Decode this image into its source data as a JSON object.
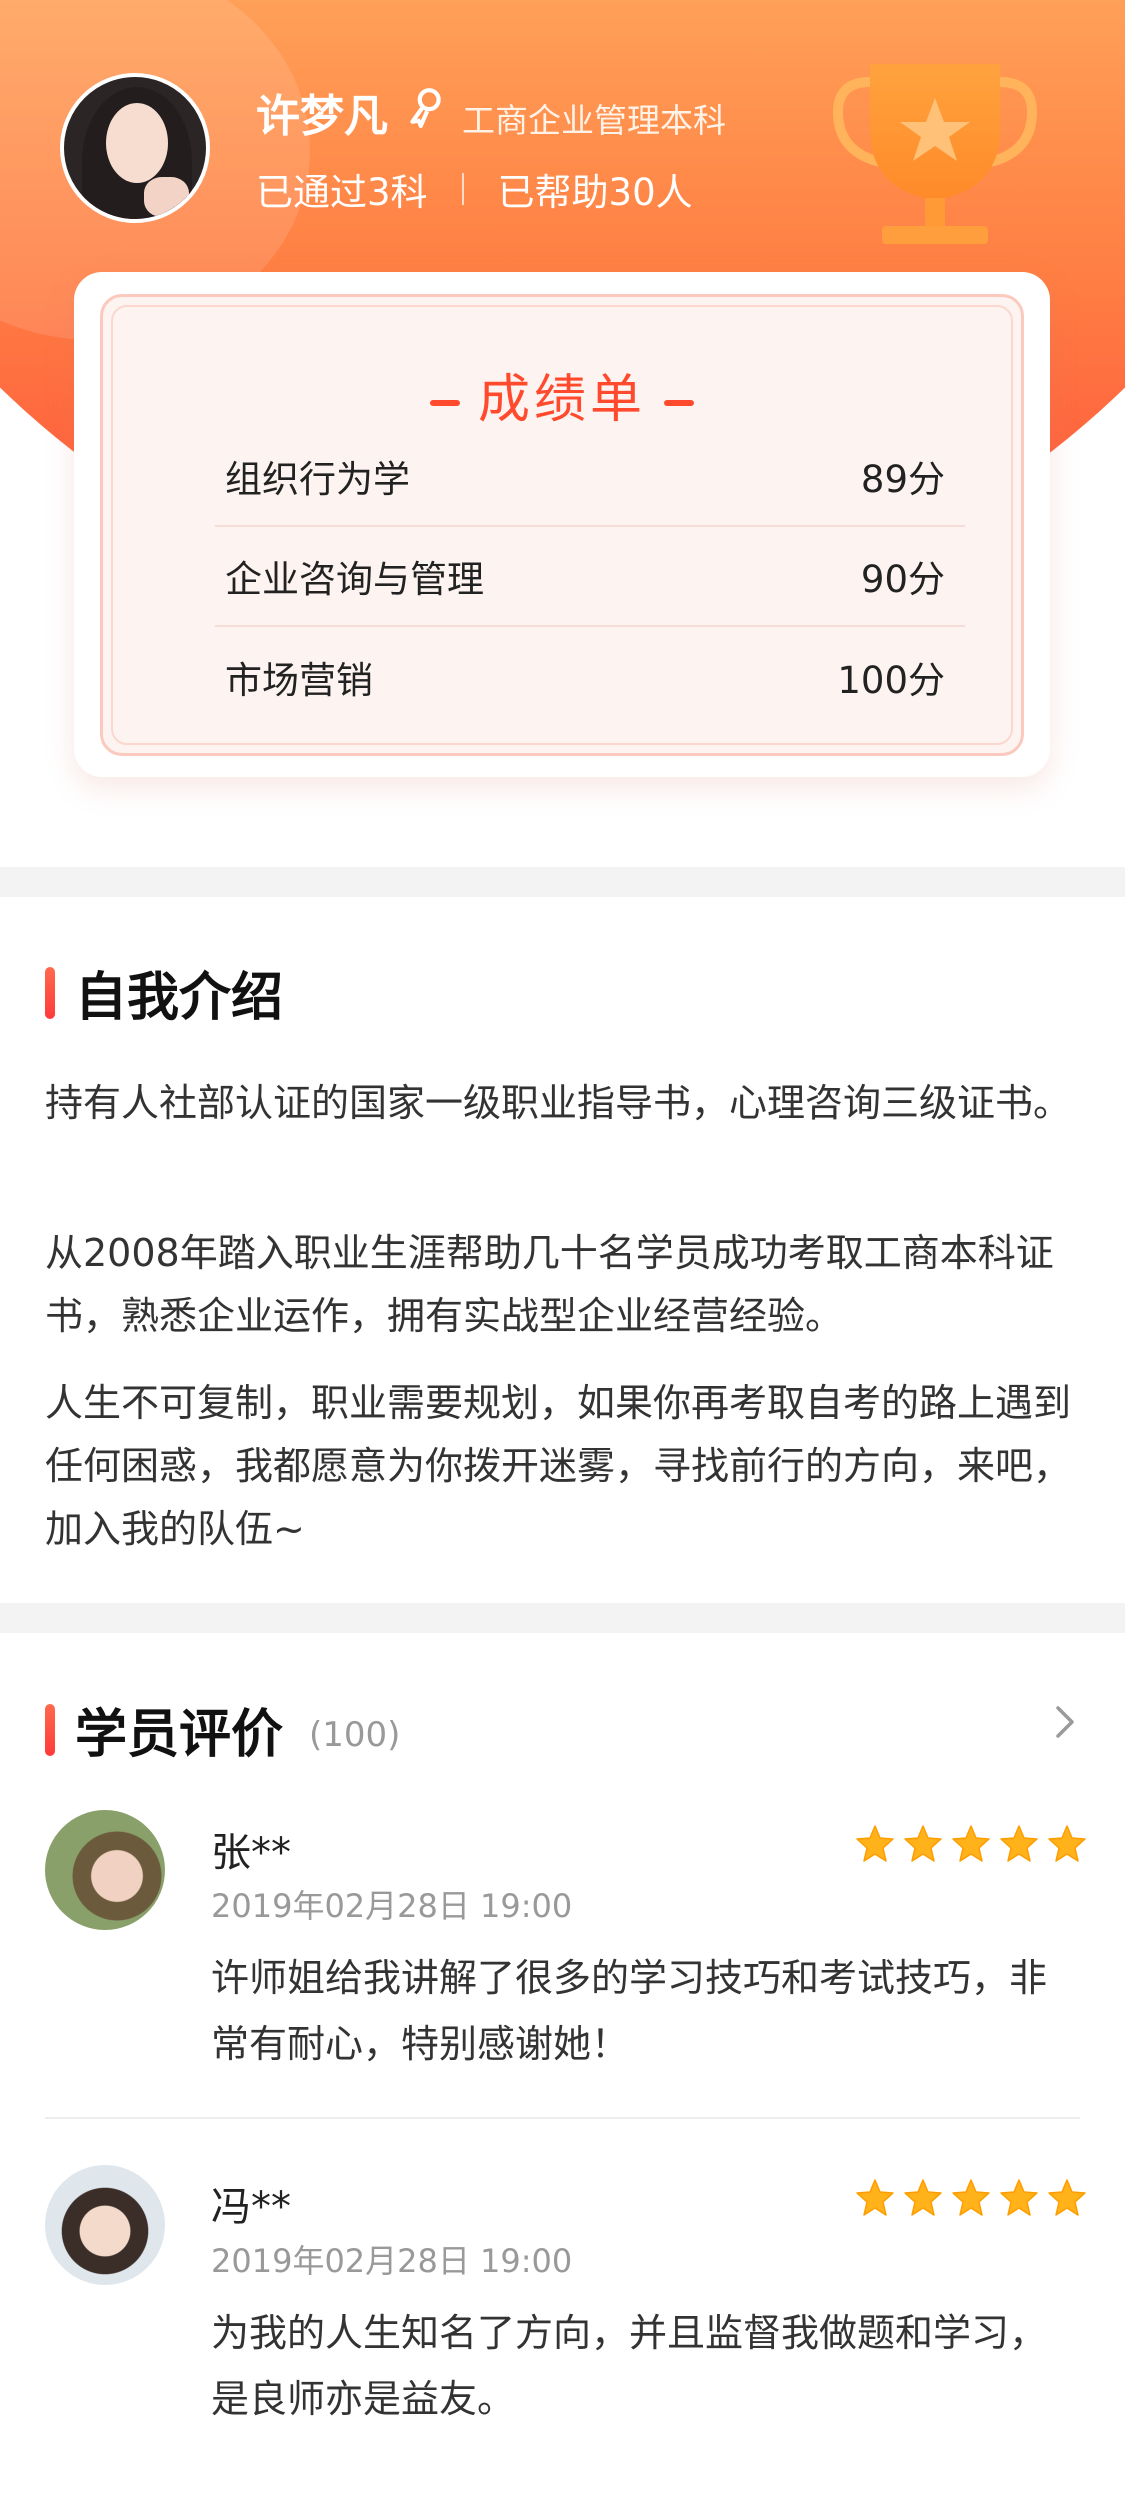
{
  "profile": {
    "name": "许梦凡",
    "major": "工商企业管理本科",
    "passed": "已通过3科",
    "helped": "已帮助30人"
  },
  "score_card": {
    "title": "成绩单",
    "rows": [
      {
        "subject": "组织行为学",
        "score": "89分"
      },
      {
        "subject": "企业咨询与管理",
        "score": "90分"
      },
      {
        "subject": "市场营销",
        "score": "100分"
      }
    ]
  },
  "intro": {
    "title": "自我介绍",
    "paragraphs": [
      "持有人社部认证的国家一级职业指导书，心理咨询三级证书。",
      "从2008年踏入职业生涯帮助几十名学员成功考取工商本科证书，熟悉企业运作，拥有实战型企业经营经验。",
      "人生不可复制，职业需要规划，如果你再考取自考的路上遇到任何困惑，我都愿意为你拨开迷雾，寻找前行的方向，来吧，加入我的队伍~"
    ]
  },
  "reviews": {
    "title": "学员评价",
    "count": "(100)",
    "items": [
      {
        "name": "张**",
        "time": "2019年02月28日 19:00",
        "rating": 5,
        "text": "许师姐给我讲解了很多的学习技巧和考试技巧，非常有耐心，特别感谢她！"
      },
      {
        "name": "冯**",
        "time": "2019年02月28日 19:00",
        "rating": 5,
        "text": "为我的人生知名了方向，并且监督我做题和学习，是良师亦是益友。"
      }
    ]
  },
  "colors": {
    "accent": "#ff4a2e",
    "header_top": "#ffa45a",
    "header_bottom": "#ff4d3a",
    "star": "#ffb21a"
  },
  "icons": {
    "badge": "ribbon-badge-icon",
    "trophy": "trophy-icon",
    "star": "star-icon",
    "chevron": "chevron-right-icon"
  }
}
